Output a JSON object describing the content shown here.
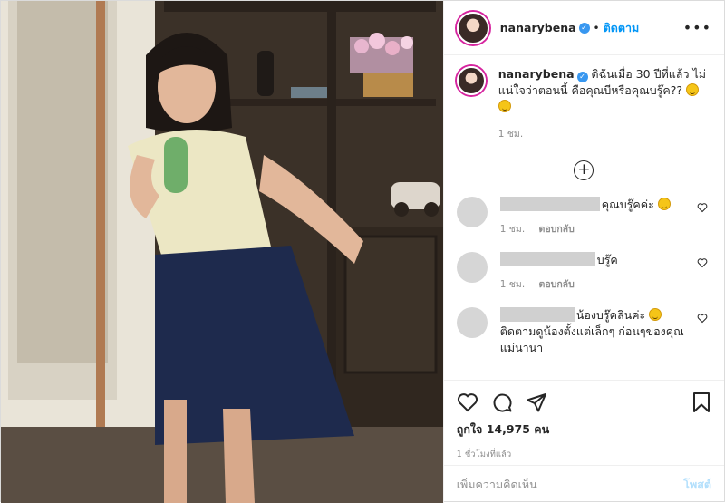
{
  "header": {
    "username": "nanarybena",
    "separator": "•",
    "follow_label": "ติดตาม",
    "more_icon": "more-horizontal-icon"
  },
  "caption": {
    "username": "nanarybena",
    "text": "ดิฉันเมื่อ 30 ปีที่แล้ว ไม่แน่ใจว่าตอนนี้ คือคุณบีหรือคุณบรู๊ค??",
    "time": "1 ชม."
  },
  "load_more_icon": "plus-circle-icon",
  "comments": [
    {
      "text": "คุณบรู๊คค่ะ",
      "time": "1 ชม.",
      "reply_label": "ตอบกลับ"
    },
    {
      "text": "บรู๊ค",
      "time": "1 ชม.",
      "reply_label": "ตอบกลับ"
    },
    {
      "text": "น้องบรู๊คลินค่ะ",
      "text2": "ติดตามดูน้องตั้งแต่เล็กๆ ก่อนๆของคุณแม่นานา"
    }
  ],
  "actions": {
    "likes_text": "ถูกใจ 14,975 คน",
    "time_ago": "1 ชั่วโมงที่แล้ว"
  },
  "add_comment": {
    "placeholder": "เพิ่มความคิดเห็น",
    "post_label": "โพสต์"
  },
  "colors": {
    "accent": "#0095f6",
    "verified": "#3897f0",
    "muted": "#8e8e8e",
    "post_disabled": "#b2dffc"
  }
}
